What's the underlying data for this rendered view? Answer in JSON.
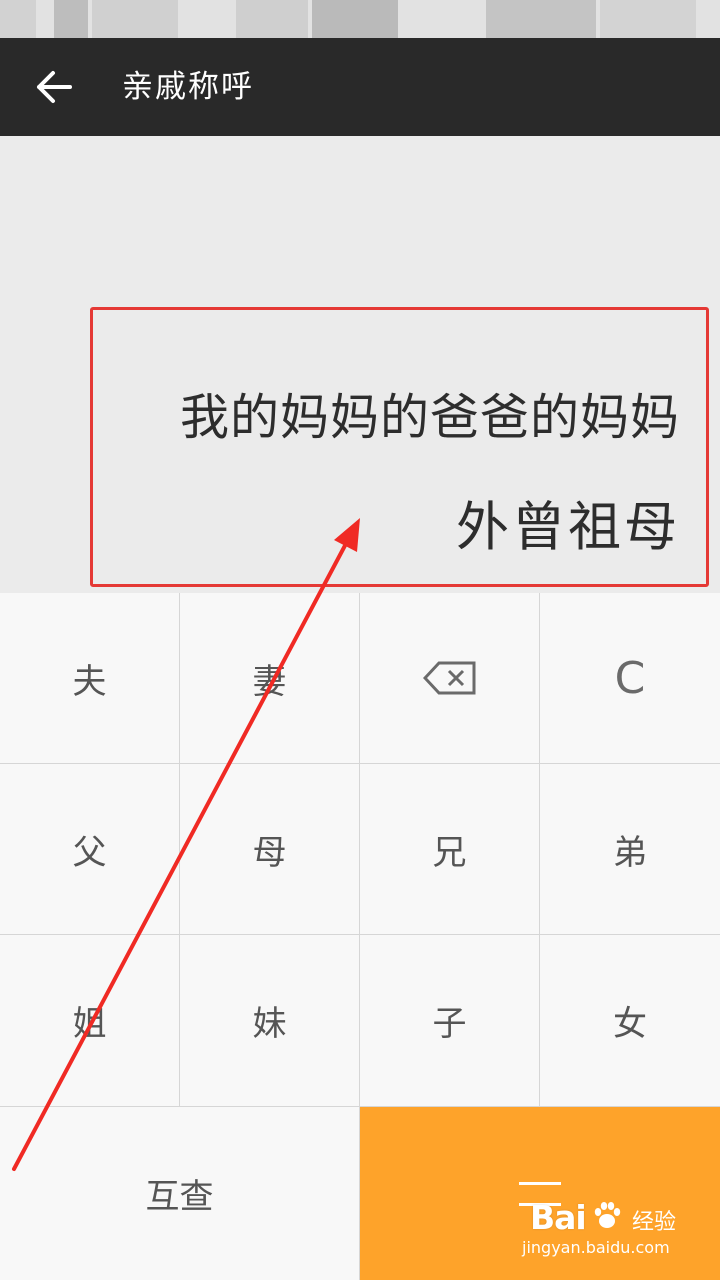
{
  "app_bar": {
    "title": "亲戚称呼",
    "back_icon": "arrow-left-icon",
    "background": "#292929"
  },
  "display": {
    "expression": "我的妈妈的爸爸的妈妈",
    "result": "外曾祖母",
    "highlight_color": "#e53935"
  },
  "keypad": {
    "keys": [
      {
        "id": "husband",
        "label": "夫"
      },
      {
        "id": "wife",
        "label": "妻"
      },
      {
        "id": "backspace",
        "label": "",
        "icon": "backspace-icon"
      },
      {
        "id": "clear",
        "label": "C"
      },
      {
        "id": "father",
        "label": "父"
      },
      {
        "id": "mother",
        "label": "母"
      },
      {
        "id": "elder-brother",
        "label": "兄"
      },
      {
        "id": "younger-brother",
        "label": "弟"
      },
      {
        "id": "elder-sister",
        "label": "姐"
      },
      {
        "id": "younger-sister",
        "label": "妹"
      },
      {
        "id": "son",
        "label": "子"
      },
      {
        "id": "daughter",
        "label": "女"
      }
    ],
    "mutual_check_label": "互查",
    "equals_icon": "equals-icon",
    "accent_color": "#fea32a"
  },
  "watermark": {
    "brand": "Bai",
    "paw_icon": "baidu-paw-icon",
    "brand_suffix": "经验",
    "url": "jingyan.baidu.com"
  }
}
